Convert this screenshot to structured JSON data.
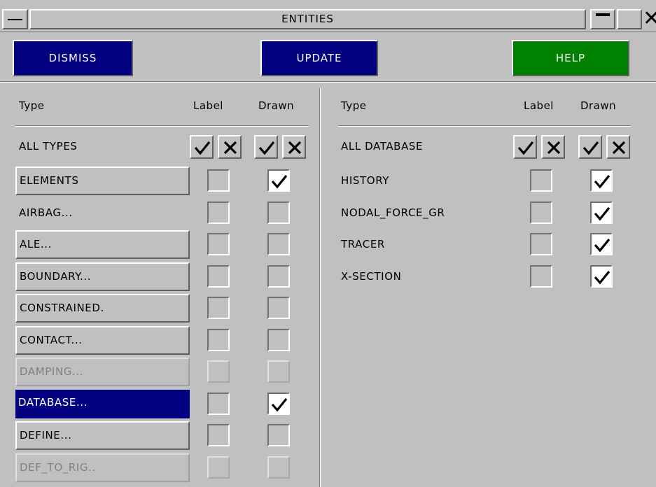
{
  "window": {
    "title": "ENTITIES",
    "menu_icon": "window-menu-icon",
    "minimize_icon": "minimize-icon",
    "maximize_icon": "maximize-icon",
    "close_icon": "close-icon"
  },
  "toolbar": {
    "dismiss_label": "DISMISS",
    "update_label": "UPDATE",
    "help_label": "HELP",
    "dismiss_color": "#000080",
    "update_color": "#000080",
    "help_color": "#008000"
  },
  "left_panel": {
    "header_type": "Type",
    "header_label": "Label",
    "header_drawn": "Drawn",
    "all_label": "ALL TYPES",
    "rows": [
      {
        "name": "ELEMENTS",
        "style": "button",
        "label_on": false,
        "drawn_on": true
      },
      {
        "name": "AIRBAG...",
        "style": "text",
        "label_on": false,
        "drawn_on": false
      },
      {
        "name": "ALE...",
        "style": "button",
        "label_on": false,
        "drawn_on": false
      },
      {
        "name": "BOUNDARY...",
        "style": "button",
        "label_on": false,
        "drawn_on": false
      },
      {
        "name": "CONSTRAINED.",
        "style": "button",
        "label_on": false,
        "drawn_on": false
      },
      {
        "name": "CONTACT...",
        "style": "button",
        "label_on": false,
        "drawn_on": false
      },
      {
        "name": "DAMPING...",
        "style": "disabled",
        "label_on": false,
        "drawn_on": false
      },
      {
        "name": "DATABASE...",
        "style": "selected",
        "label_on": false,
        "drawn_on": true
      },
      {
        "name": "DEFINE...",
        "style": "button",
        "label_on": false,
        "drawn_on": false
      },
      {
        "name": "DEF_TO_RIG..",
        "style": "disabled",
        "label_on": false,
        "drawn_on": false
      }
    ]
  },
  "right_panel": {
    "header_type": "Type",
    "header_label": "Label",
    "header_drawn": "Drawn",
    "all_label": "ALL DATABASE",
    "rows": [
      {
        "name": "HISTORY",
        "label_on": false,
        "drawn_on": true
      },
      {
        "name": "NODAL_FORCE_GR",
        "label_on": false,
        "drawn_on": true
      },
      {
        "name": "TRACER",
        "label_on": false,
        "drawn_on": true
      },
      {
        "name": "X-SECTION",
        "label_on": false,
        "drawn_on": true
      }
    ]
  }
}
